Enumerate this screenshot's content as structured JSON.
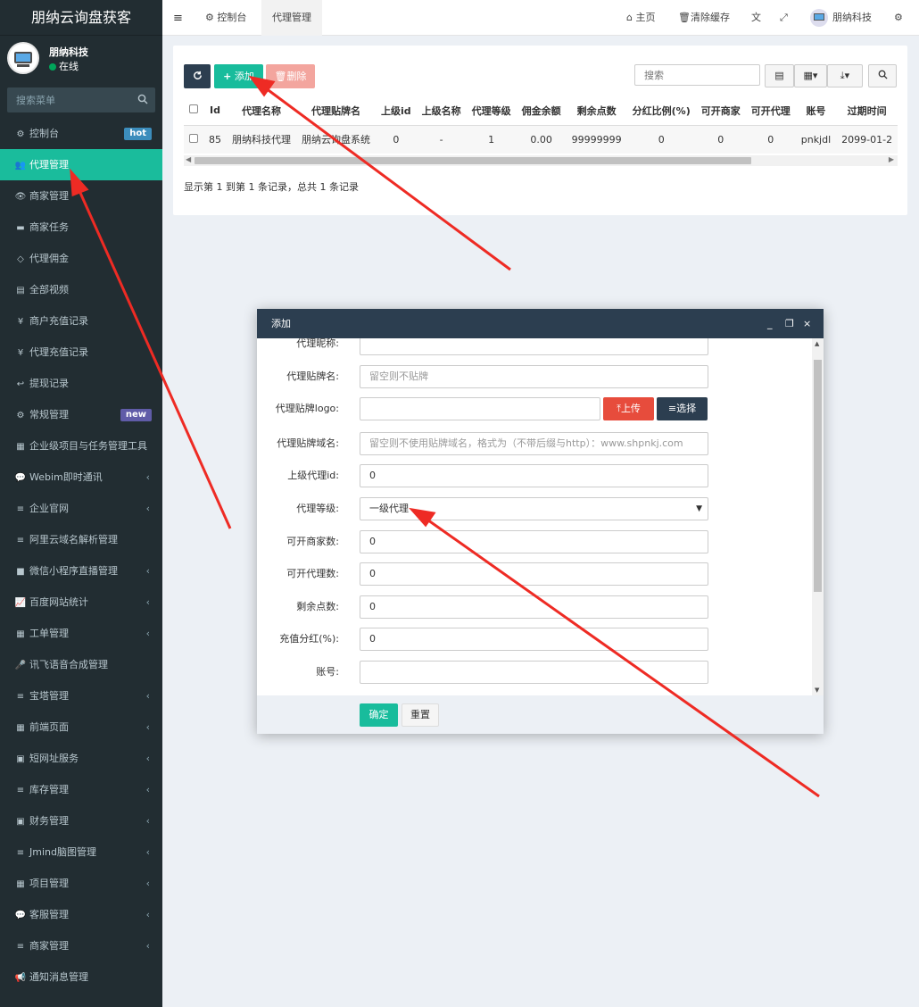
{
  "sidebar": {
    "brand": "朋纳云询盘获客",
    "user_name": "朋纳科技",
    "user_status": "在线",
    "search_placeholder": "搜索菜单",
    "items": [
      {
        "icon": "⚙",
        "label": "控制台",
        "badge": "hot"
      },
      {
        "icon": "👥",
        "label": "代理管理",
        "active": true
      },
      {
        "icon": "👁",
        "label": "商家管理"
      },
      {
        "icon": "▬",
        "label": "商家任务"
      },
      {
        "icon": "◇",
        "label": "代理佣金"
      },
      {
        "icon": "▤",
        "label": "全部视频"
      },
      {
        "icon": "¥",
        "label": "商户充值记录"
      },
      {
        "icon": "¥",
        "label": "代理充值记录"
      },
      {
        "icon": "↩",
        "label": "提现记录"
      },
      {
        "icon": "⚙",
        "label": "常规管理",
        "badge": "new"
      },
      {
        "icon": "▦",
        "label": "企业级项目与任务管理工具"
      },
      {
        "icon": "💬",
        "label": "Webim即时通讯",
        "chevron": true
      },
      {
        "icon": "≡",
        "label": "企业官网",
        "chevron": true
      },
      {
        "icon": "≡",
        "label": "阿里云域名解析管理"
      },
      {
        "icon": "■",
        "label": "微信小程序直播管理",
        "chevron": true
      },
      {
        "icon": "📈",
        "label": "百度网站统计",
        "chevron": true
      },
      {
        "icon": "▦",
        "label": "工单管理",
        "chevron": true
      },
      {
        "icon": "🎤",
        "label": "讯飞语音合成管理"
      },
      {
        "icon": "≡",
        "label": "宝塔管理",
        "chevron": true
      },
      {
        "icon": "▦",
        "label": "前端页面",
        "chevron": true
      },
      {
        "icon": "▣",
        "label": "短网址服务",
        "chevron": true
      },
      {
        "icon": "≡",
        "label": "库存管理",
        "chevron": true
      },
      {
        "icon": "▣",
        "label": "财务管理",
        "chevron": true
      },
      {
        "icon": "≡",
        "label": "Jmind脑图管理",
        "chevron": true
      },
      {
        "icon": "▦",
        "label": "项目管理",
        "chevron": true
      },
      {
        "icon": "💬",
        "label": "客服管理",
        "chevron": true
      },
      {
        "icon": "≡",
        "label": "商家管理",
        "chevron": true
      },
      {
        "icon": "📢",
        "label": "通知消息管理"
      }
    ]
  },
  "header": {
    "tabs": [
      "控制台",
      "代理管理"
    ],
    "home": "主页",
    "clear_cache": "清除缓存",
    "user": "朋纳科技"
  },
  "toolbar": {
    "add": "添加",
    "delete": "删除",
    "search_placeholder": "搜索"
  },
  "table": {
    "columns": [
      "Id",
      "代理名称",
      "代理贴牌名",
      "上级id",
      "上级名称",
      "代理等级",
      "佣金余额",
      "剩余点数",
      "分红比例(%)",
      "可开商家",
      "可开代理",
      "账号",
      "过期时间"
    ],
    "rows": [
      [
        "85",
        "朋纳科技代理",
        "朋纳云询盘系统",
        "0",
        "-",
        "1",
        "0.00",
        "99999999",
        "0",
        "0",
        "0",
        "pnkjdl",
        "2099-01-2"
      ]
    ],
    "summary": "显示第 1 到第 1 条记录，总共 1 条记录"
  },
  "modal": {
    "title": "添加",
    "fields": [
      {
        "label": "代理昵称:",
        "value": "",
        "placeholder": ""
      },
      {
        "label": "代理贴牌名:",
        "value": "",
        "placeholder": "留空则不贴牌"
      },
      {
        "label": "代理贴牌logo:",
        "value": "",
        "placeholder": ""
      },
      {
        "label": "代理贴牌域名:",
        "value": "",
        "placeholder": "留空则不使用贴牌域名，格式为（不带后缀与http）：www.shpnkj.com"
      },
      {
        "label": "上级代理id:",
        "value": "0",
        "placeholder": ""
      },
      {
        "label": "代理等级:",
        "value": "一级代理",
        "placeholder": ""
      },
      {
        "label": "可开商家数:",
        "value": "0",
        "placeholder": ""
      },
      {
        "label": "可开代理数:",
        "value": "0",
        "placeholder": ""
      },
      {
        "label": "剩余点数:",
        "value": "0",
        "placeholder": ""
      },
      {
        "label": "充值分红(%):",
        "value": "0",
        "placeholder": ""
      },
      {
        "label": "账号:",
        "value": "",
        "placeholder": ""
      }
    ],
    "upload": "上传",
    "choose": "选择",
    "ok": "确定",
    "reset": "重置"
  },
  "colors": {
    "sidebar_bg": "#222d32",
    "active": "#1abc9c",
    "navy": "#2c3e50",
    "danger": "#e74c3c",
    "arrow": "#ee2b24"
  }
}
